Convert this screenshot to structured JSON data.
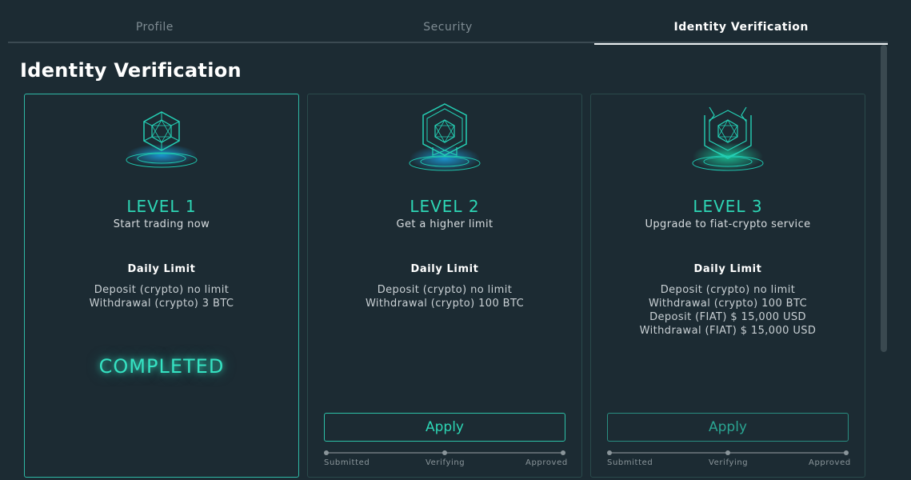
{
  "tabs": [
    {
      "label": "Profile",
      "active": false
    },
    {
      "label": "Security",
      "active": false
    },
    {
      "label": "Identity Verification",
      "active": true
    }
  ],
  "page_title": "Identity Verification",
  "colors": {
    "accent": "#2dd6b5",
    "background": "#1c2b33",
    "card_border": "#2a4a4b"
  },
  "cards": [
    {
      "level": "LEVEL 1",
      "subtitle": "Start trading now",
      "limit_title": "Daily Limit",
      "limits": [
        "Deposit (crypto) no limit",
        "Withdrawal (crypto) 3 BTC"
      ],
      "status": "COMPLETED",
      "icon": "hexagon-gem-icon"
    },
    {
      "level": "LEVEL 2",
      "subtitle": "Get a higher limit",
      "limit_title": "Daily Limit",
      "limits": [
        "Deposit (crypto) no limit",
        "Withdrawal (crypto) 100 BTC"
      ],
      "apply_label": "Apply",
      "steps": [
        "Submitted",
        "Verifying",
        "Approved"
      ],
      "icon": "hexagon-badge-icon"
    },
    {
      "level": "LEVEL 3",
      "subtitle": "Upgrade to fiat-crypto service",
      "limit_title": "Daily Limit",
      "limits": [
        "Deposit (crypto) no limit",
        "Withdrawal (crypto) 100 BTC",
        "Deposit (FIAT) $ 15,000 USD",
        "Withdrawal (FIAT) $ 15,000 USD"
      ],
      "apply_label": "Apply",
      "steps": [
        "Submitted",
        "Verifying",
        "Approved"
      ],
      "icon": "crown-shield-icon"
    }
  ]
}
